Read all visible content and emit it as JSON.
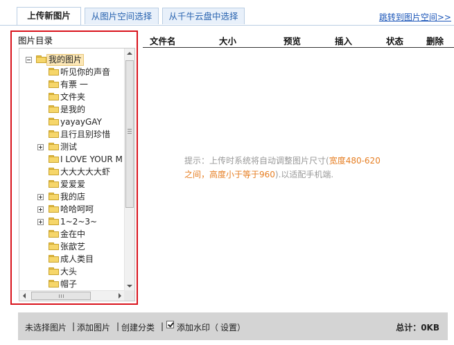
{
  "tabs": [
    {
      "label": "上传新图片",
      "active": true
    },
    {
      "label": "从图片空间选择",
      "active": false
    },
    {
      "label": "从千牛云盘中选择",
      "active": false
    }
  ],
  "jump_link": "跳转到图片空间>>",
  "tree": {
    "title": "图片目录",
    "root": "我的图片",
    "items": [
      {
        "label": "听见你的声音",
        "expandable": false
      },
      {
        "label": "有票 一",
        "expandable": false
      },
      {
        "label": "文件夹",
        "expandable": false
      },
      {
        "label": "是我的",
        "expandable": false
      },
      {
        "label": "yayayGAY",
        "expandable": false
      },
      {
        "label": "且行且别珍惜",
        "expandable": false
      },
      {
        "label": "测试",
        "expandable": true
      },
      {
        "label": "I LOVE YOUR M",
        "expandable": false
      },
      {
        "label": "大大大大大虾",
        "expandable": false
      },
      {
        "label": "爱爱爱",
        "expandable": false
      },
      {
        "label": "我的店",
        "expandable": true
      },
      {
        "label": "哈哈呵呵",
        "expandable": true
      },
      {
        "label": "1~2~3~",
        "expandable": true
      },
      {
        "label": "金在中",
        "expandable": false
      },
      {
        "label": "张歆艺",
        "expandable": false
      },
      {
        "label": "成人类目",
        "expandable": false
      },
      {
        "label": "大头",
        "expandable": false
      },
      {
        "label": "帽子",
        "expandable": false
      }
    ]
  },
  "columns": [
    "文件名",
    "大小",
    "预览",
    "插入",
    "状态",
    "删除"
  ],
  "hint": {
    "prefix": "提示：上传时系统将自动调整图片尺寸(",
    "highlight1": "宽度480-620",
    "highlight2": "之间，高度小于等于960",
    "suffix": ").以适配手机端."
  },
  "footer": {
    "status": "未选择图片",
    "sep1": "|",
    "add_image": "添加图片",
    "sep2": "|",
    "create_category": "创建分类",
    "sep3": "|",
    "watermark_label": "添加水印（",
    "settings": "设置",
    "close_paren": "）",
    "watermark_checked": true,
    "total": "总计：0KB"
  },
  "colors": {
    "accent": "#1a55b8",
    "border_highlight": "#d9121b",
    "hint_orange": "#e67e22"
  }
}
